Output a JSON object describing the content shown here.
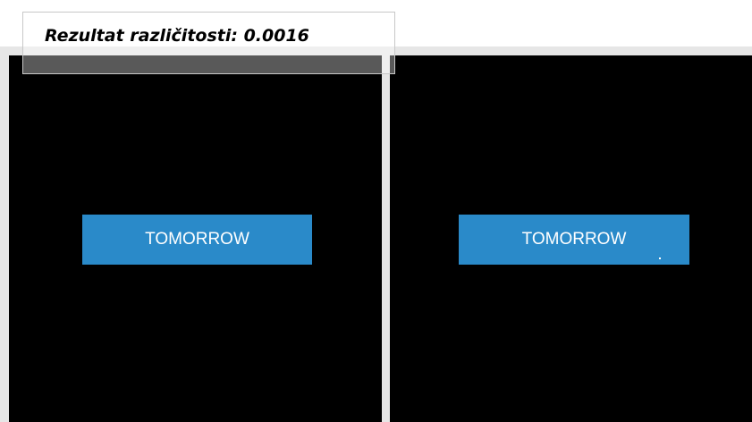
{
  "score": {
    "text": "Rezultat različitosti: 0.0016"
  },
  "panels": {
    "left": {
      "button_label": "TOMORROW"
    },
    "right": {
      "button_label": "TOMORROW"
    }
  },
  "colors": {
    "button": "#2a8ac9",
    "panel_background": "#000000",
    "frame": "#e6e6e6"
  }
}
